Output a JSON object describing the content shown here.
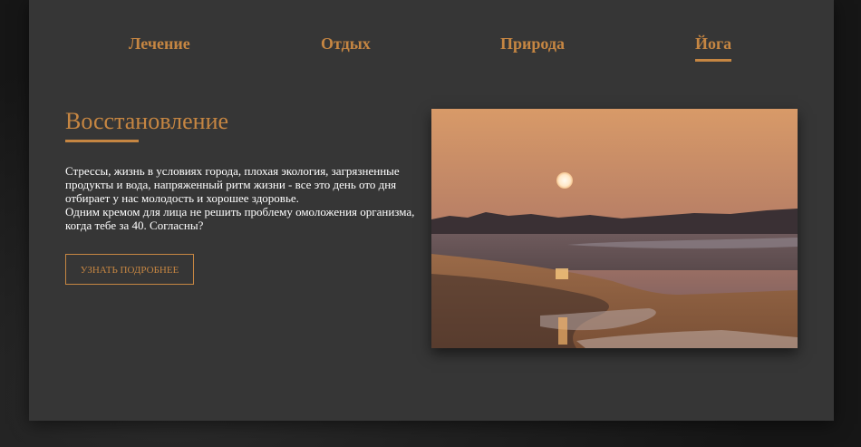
{
  "nav": {
    "items": [
      {
        "label": "Лечение"
      },
      {
        "label": "Отдых"
      },
      {
        "label": "Природа"
      },
      {
        "label": "Йога",
        "active": true
      }
    ]
  },
  "hero": {
    "heading": "Восстановление",
    "paragraph_1": "Стрессы, жизнь в условиях города, плохая экология, загрязненные продукты и вода, напряженный ритм жизни - все это день ото дня отбирает у нас молодость и хорошее здоровье.",
    "paragraph_2": "Одним кремом для лица не решить проблему омоложения организма, когда тебе за 40. Согласны?",
    "button_label": "УЗНАТЬ ПОДРОБНЕЕ",
    "image_icon": "sunset-beach-photo"
  },
  "colors": {
    "accent": "#c68642",
    "card_background": "#363636",
    "page_background": "#1c1c1c",
    "text": "#ffffff"
  }
}
